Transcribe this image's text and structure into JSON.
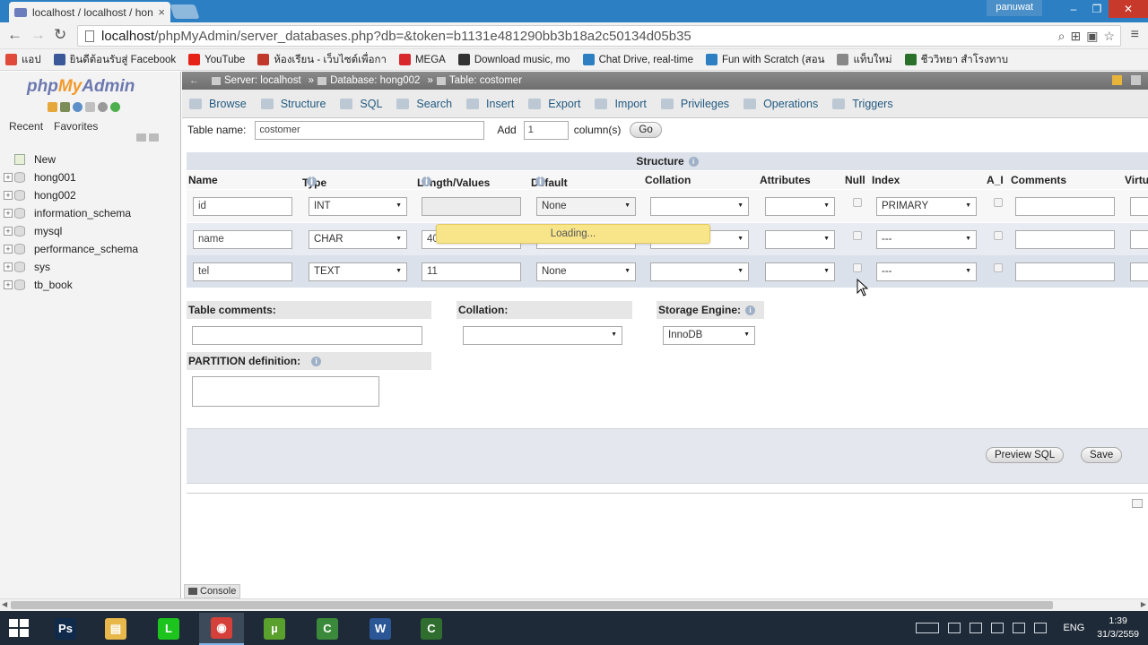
{
  "browser": {
    "tab_title": "localhost / localhost / hon",
    "tab_close": "×",
    "user": "panuwat",
    "url_host": "localhost",
    "url_path": "/phpMyAdmin/server_databases.php?db=&token=b1131e481290bb3b18a2c50134d05b35",
    "bookmarks": [
      {
        "label": "แอป",
        "icon": "apps-icon",
        "color": "#e04a3a"
      },
      {
        "label": "ยินดีต้อนรับสู่ Facebook",
        "icon": "facebook-icon",
        "color": "#3b5998"
      },
      {
        "label": "YouTube",
        "icon": "youtube-icon",
        "color": "#e62117"
      },
      {
        "label": "ห้องเรียน - เว็บไซต์เพื่อกา",
        "icon": "classroom-icon",
        "color": "#c0392b"
      },
      {
        "label": "MEGA",
        "icon": "mega-icon",
        "color": "#d9272e"
      },
      {
        "label": "Download music, mo",
        "icon": "download-icon",
        "color": "#333333"
      },
      {
        "label": "Chat Drive, real-time",
        "icon": "chat-icon",
        "color": "#2d7fc1"
      },
      {
        "label": "Fun with Scratch (สอน",
        "icon": "info-icon",
        "color": "#2d7fc1"
      },
      {
        "label": "แท็บใหม่",
        "icon": "page-icon",
        "color": "#888888"
      },
      {
        "label": "ชีววิทยา สำโรงทาบ",
        "icon": "bio-icon",
        "color": "#2a6f2a"
      }
    ]
  },
  "sidebar": {
    "logo_php": "php",
    "logo_my": "My",
    "logo_admin": "Admin",
    "recent": "Recent",
    "favorites": "Favorites",
    "items": [
      {
        "label": "New",
        "type": "new"
      },
      {
        "label": "hong001",
        "type": "db"
      },
      {
        "label": "hong002",
        "type": "db"
      },
      {
        "label": "information_schema",
        "type": "db"
      },
      {
        "label": "mysql",
        "type": "db"
      },
      {
        "label": "performance_schema",
        "type": "db"
      },
      {
        "label": "sys",
        "type": "db"
      },
      {
        "label": "tb_book",
        "type": "db"
      }
    ]
  },
  "breadcrumb": {
    "server": "Server: localhost",
    "database": "Database: hong002",
    "table": "Table: costomer",
    "sep": "»"
  },
  "tabs": [
    "Browse",
    "Structure",
    "SQL",
    "Search",
    "Insert",
    "Export",
    "Import",
    "Privileges",
    "Operations",
    "Triggers"
  ],
  "form": {
    "table_name_label": "Table name:",
    "table_name_value": "costomer",
    "add_label": "Add",
    "add_value": "1",
    "columns_label": "column(s)",
    "go_label": "Go",
    "structure_label": "Structure",
    "columns": [
      "Name",
      "Type",
      "Length/Values",
      "Default",
      "Collation",
      "Attributes",
      "Null",
      "Index",
      "A_I",
      "Comments",
      "Virtu"
    ],
    "rows": [
      {
        "name": "id",
        "type": "INT",
        "length": "",
        "default": "None",
        "index": "PRIMARY"
      },
      {
        "name": "name",
        "type": "CHAR",
        "length": "40",
        "default": "",
        "index": "---"
      },
      {
        "name": "tel",
        "type": "TEXT",
        "length": "11",
        "default": "None",
        "index": "---"
      }
    ],
    "loading": "Loading...",
    "table_comments_label": "Table comments:",
    "collation_label": "Collation:",
    "storage_engine_label": "Storage Engine:",
    "storage_engine_value": "InnoDB",
    "partition_label": "PARTITION definition:",
    "preview_sql": "Preview SQL",
    "save": "Save",
    "console": "Console"
  },
  "taskbar": {
    "lang": "ENG",
    "time": "1:39",
    "date": "31/3/2559",
    "apps": [
      {
        "name": "photoshop",
        "glyph": "Ps",
        "color": "#0f2a4a"
      },
      {
        "name": "file-explorer",
        "glyph": "▤",
        "color": "#e8b84a"
      },
      {
        "name": "line",
        "glyph": "L",
        "color": "#1ec41e"
      },
      {
        "name": "chrome",
        "glyph": "◉",
        "color": "#d6403a"
      },
      {
        "name": "utorrent",
        "glyph": "µ",
        "color": "#5aa02c"
      },
      {
        "name": "camtasia-recorder",
        "glyph": "C",
        "color": "#3b8a3b"
      },
      {
        "name": "word",
        "glyph": "W",
        "color": "#2b5797"
      },
      {
        "name": "camtasia",
        "glyph": "C",
        "color": "#2f6e2f"
      }
    ]
  }
}
